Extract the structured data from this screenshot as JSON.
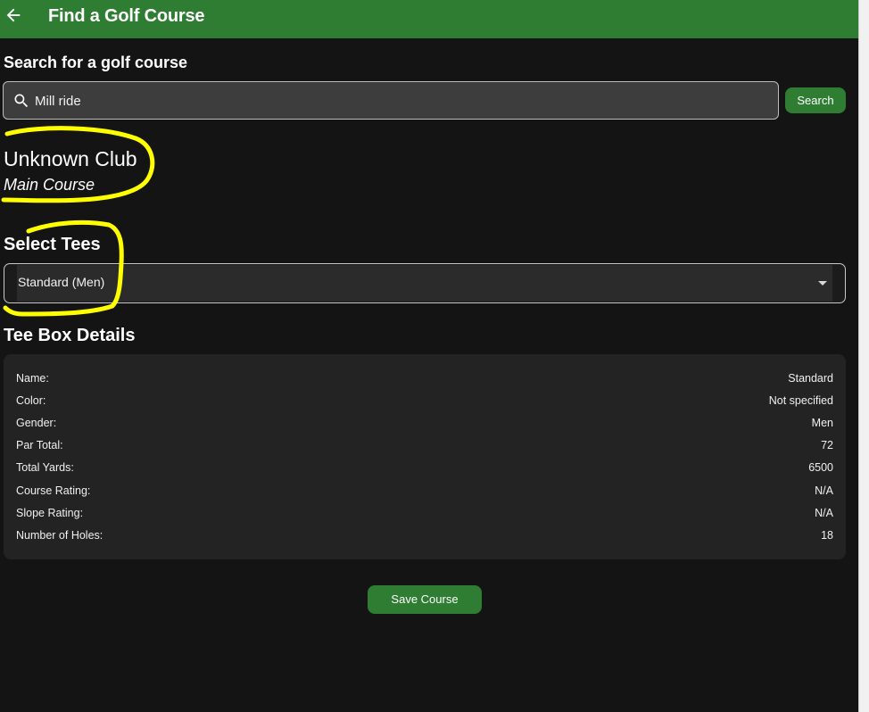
{
  "app_bar": {
    "title": "Find a Golf Course",
    "back_icon": "arrow-left-icon",
    "color": "#2e7d32"
  },
  "search": {
    "label": "Search for a golf course",
    "value": "Mill ride",
    "icon": "search-icon",
    "button_label": "Search"
  },
  "course": {
    "club_name": "Unknown Club",
    "course_name": "Main Course"
  },
  "tees": {
    "label": "Select Tees",
    "selected": "Standard (Men)",
    "icon": "chevron-down-icon"
  },
  "tee_box": {
    "title": "Tee Box Details",
    "rows": [
      {
        "label": "Name:",
        "value": "Standard"
      },
      {
        "label": "Color:",
        "value": "Not specified"
      },
      {
        "label": "Gender:",
        "value": "Men"
      },
      {
        "label": "Par Total:",
        "value": "72"
      },
      {
        "label": "Total Yards:",
        "value": "6500"
      },
      {
        "label": "Course Rating:",
        "value": "N/A"
      },
      {
        "label": "Slope Rating:",
        "value": "N/A"
      },
      {
        "label": "Number of Holes:",
        "value": "18"
      }
    ]
  },
  "actions": {
    "save_label": "Save Course"
  },
  "theme": {
    "accent": "#2e7d32",
    "background": "#141414",
    "annotation": "#ffff00"
  }
}
